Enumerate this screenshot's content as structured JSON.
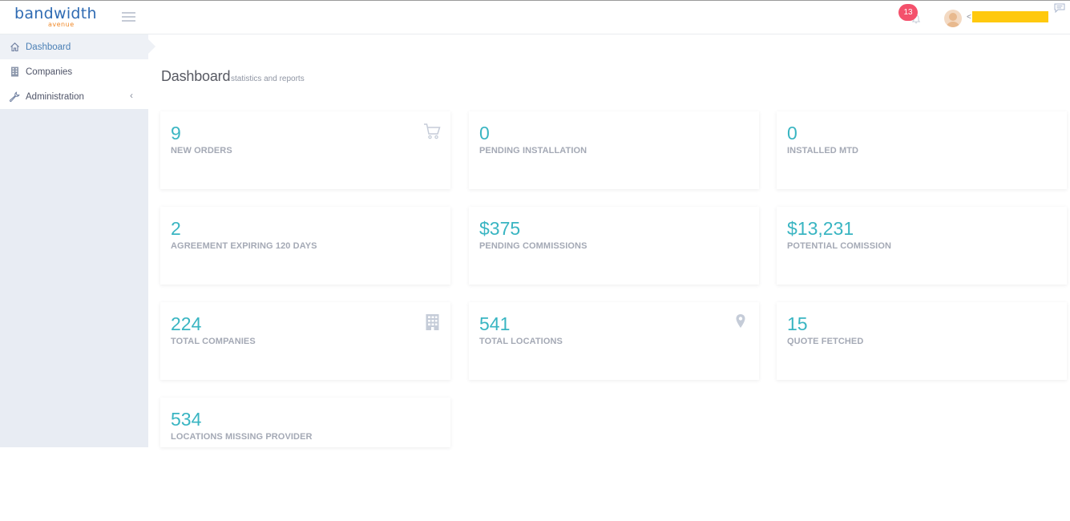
{
  "header": {
    "logo_main": "bandwidth",
    "logo_sub": "avenue",
    "notifications_count": "13",
    "user_caret": "<",
    "icons": [
      "hamburger-menu-icon",
      "bell-icon",
      "avatar",
      "chat-icon"
    ]
  },
  "sidebar": {
    "items": [
      {
        "label": "Dashboard",
        "icon": "home-icon",
        "active": true
      },
      {
        "label": "Companies",
        "icon": "building-icon",
        "active": false
      },
      {
        "label": "Administration",
        "icon": "wrench-icon",
        "active": false,
        "arrow": "‹"
      }
    ]
  },
  "page": {
    "title": "Dashboard",
    "subtitle": "statistics and reports"
  },
  "cards": [
    {
      "value": "9",
      "label": "NEW ORDERS",
      "icon": "cart-icon"
    },
    {
      "value": "0",
      "label": "PENDING INSTALLATION",
      "icon": ""
    },
    {
      "value": "0",
      "label": "INSTALLED MTD",
      "icon": ""
    },
    {
      "value": "2",
      "label": "AGREEMENT EXPIRING 120 DAYS",
      "icon": ""
    },
    {
      "value": "$375",
      "label": "PENDING COMMISSIONS",
      "icon": ""
    },
    {
      "value": "$13,231",
      "label": "POTENTIAL COMISSION",
      "icon": ""
    },
    {
      "value": "224",
      "label": "TOTAL COMPANIES",
      "icon": "building-icon"
    },
    {
      "value": "541",
      "label": "TOTAL LOCATIONS",
      "icon": "map-pin-icon"
    },
    {
      "value": "15",
      "label": "QUOTE FETCHED",
      "icon": ""
    },
    {
      "value": "534",
      "label": "LOCATIONS MISSING PROVIDER",
      "icon": ""
    }
  ],
  "colors": {
    "accent": "#39b5c2",
    "brand": "#2f6bb3",
    "brand_secondary": "#f08a2a",
    "badge": "#f4516c",
    "sidebar_bg": "#e8ecf3",
    "label": "#a4a9b5"
  }
}
